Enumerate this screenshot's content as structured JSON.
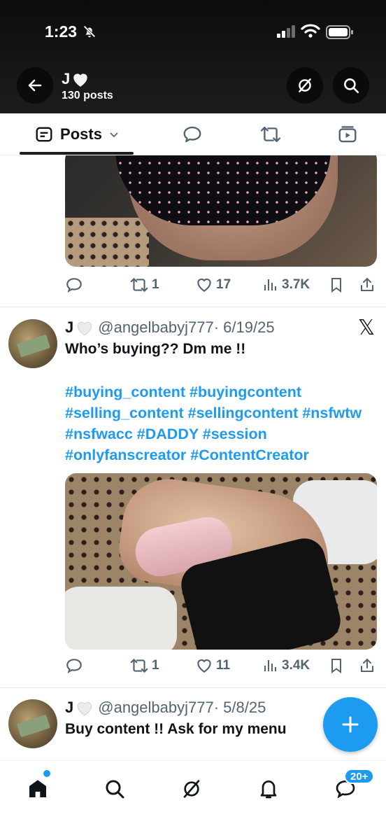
{
  "status_bar": {
    "time": "1:23"
  },
  "profile": {
    "name": "J",
    "posts_count": "130 posts"
  },
  "tabs": [
    {
      "label": "Posts",
      "active": true
    },
    {
      "label": "",
      "icon": "reply-icon"
    },
    {
      "label": "",
      "icon": "repost-icon"
    },
    {
      "label": "",
      "icon": "media-icon"
    }
  ],
  "feed": {
    "prev_post": {
      "actions": {
        "replies": "",
        "reposts": "1",
        "likes": "17",
        "views": "3.7K"
      }
    },
    "post1": {
      "name": "J",
      "handle": "@angelbabyj777",
      "date": "· 6/19/25",
      "text": "Who’s buying?? Dm me !!",
      "hashtags": "#buying_content #buyingcontent #selling_content #sellingcontent #nsfwtw #nsfwacc #DADDY #session #onlyfanscreator #ContentCreator",
      "actions": {
        "replies": "",
        "reposts": "1",
        "likes": "11",
        "views": "3.4K"
      }
    },
    "post2": {
      "name": "J",
      "handle": "@angelbabyj777",
      "date": "· 5/8/25",
      "text": "Buy content !! Ask for my menu"
    }
  },
  "bottom_nav": {
    "messages_badge": "20+"
  },
  "colors": {
    "accent": "#1d9bf0",
    "text": "#0f1419",
    "secondary": "#536471"
  }
}
